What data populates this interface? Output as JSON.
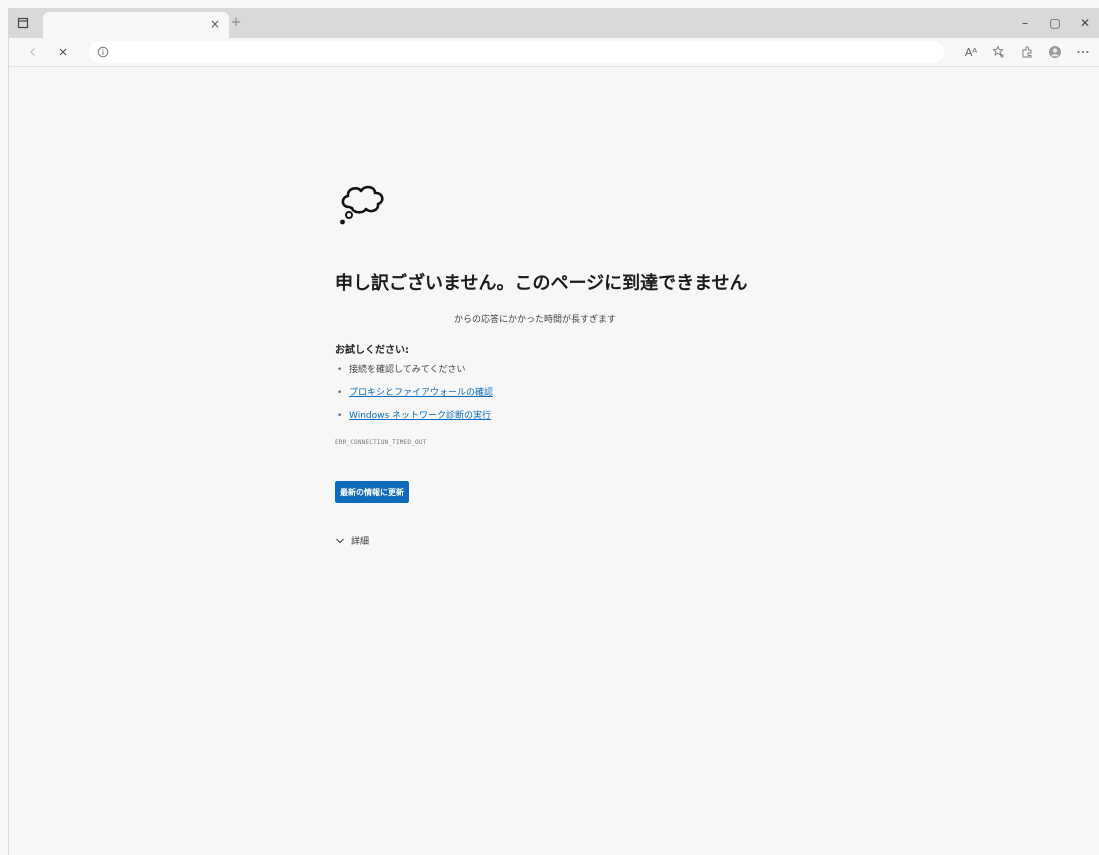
{
  "browser": {
    "tab": {
      "title": "",
      "close_glyph": "×"
    },
    "new_tab_glyph": "+",
    "window_controls": {
      "minimize": "–",
      "maximize": "▢",
      "close": "✕"
    },
    "address": {
      "value": "",
      "placeholder": ""
    },
    "toolbar": {
      "read_aloud": "Aᴬ"
    }
  },
  "error_page": {
    "title": "申し訳ございません。このページに到達できません",
    "subtitle": "からの応答にかかった時間が長すぎます",
    "try_label": "お試しください:",
    "suggestions": [
      {
        "text": "接続を確認してみてください"
      },
      {
        "text": "プロキシとファイアウォールの確認"
      },
      {
        "text": "Windows ネットワーク診断の実行"
      }
    ],
    "error_code": "ERR_CONNECTION_TIMED_OUT",
    "refresh_button": "最新の情報に更新",
    "details_label": "詳細"
  },
  "colors": {
    "accent": "#0f6cbd",
    "link": "#0f6cbd"
  }
}
